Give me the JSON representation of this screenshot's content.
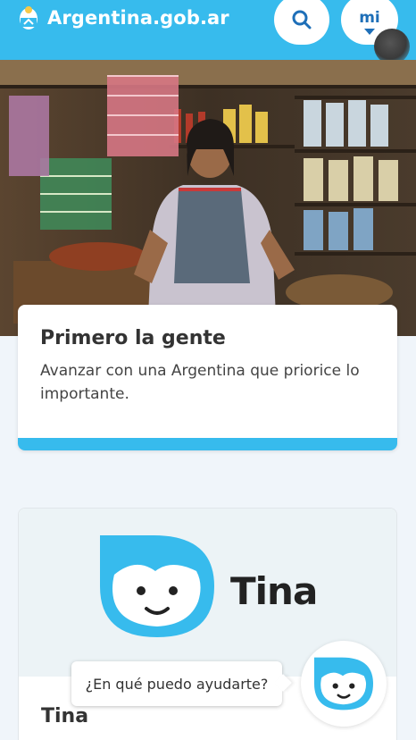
{
  "header": {
    "site_name": "Argentina.gob.ar",
    "mi_label": "mi",
    "brand_color": "#37bbed"
  },
  "hero": {
    "alt": "Comerciante en su almacén"
  },
  "main_card": {
    "title": "Primero la gente",
    "text": "Avanzar con una Argentina que priorice lo importante."
  },
  "tina_card": {
    "logo_text": "Tina",
    "title": "Tina"
  },
  "chat": {
    "bubble_text": "¿En qué puedo ayudarte?"
  },
  "icons": [
    "crest-icon",
    "search-icon",
    "chevron-down-icon",
    "tina-face-icon"
  ]
}
